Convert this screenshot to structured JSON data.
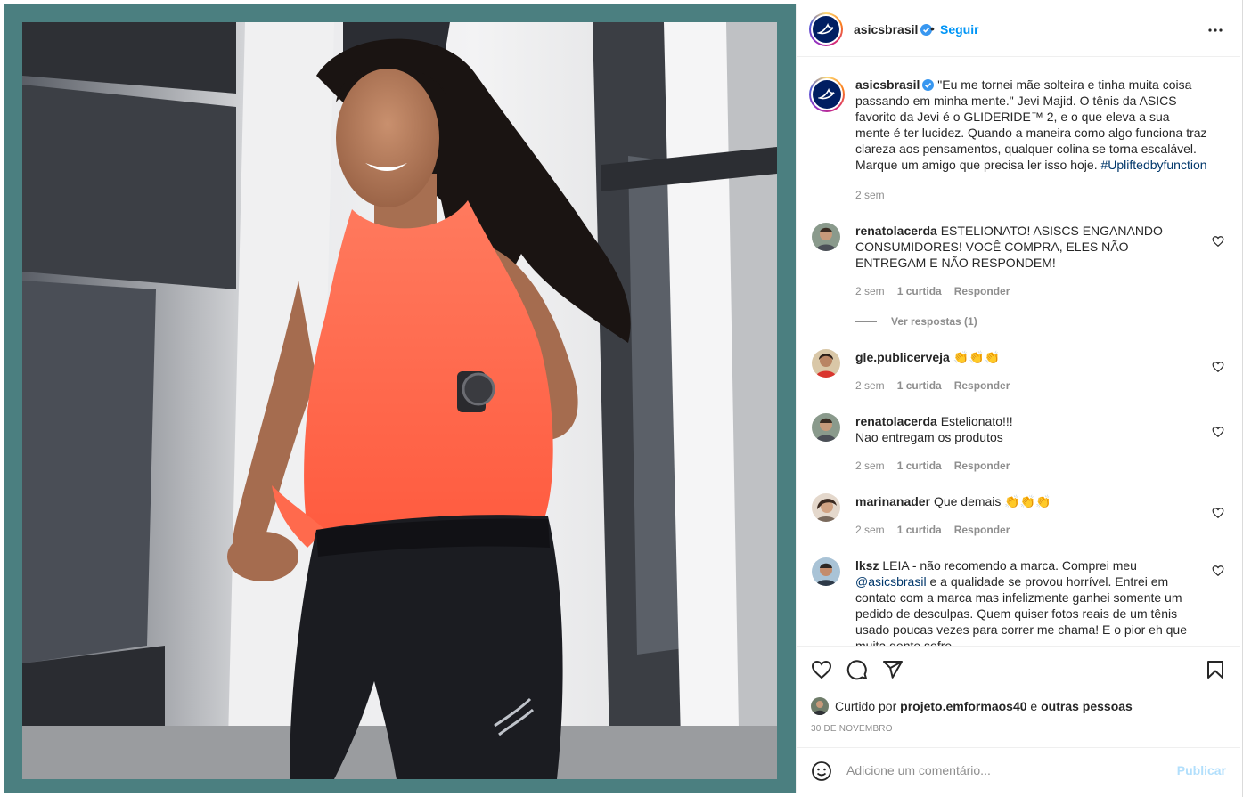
{
  "post": {
    "username": "asicsbrasil",
    "follow_label": "Seguir",
    "dot": "•",
    "caption": {
      "username": "asicsbrasil",
      "text": "\"Eu me tornei mãe solteira e tinha muita coisa passando em minha mente.\" Jevi Majid. O tênis da ASICS favorito da Jevi é o GLIDERIDE™ 2, e o que eleva a sua mente é ter lucidez. Quando a maneira como algo funciona traz clareza aos pensamentos, qualquer colina se torna escalável. Marque um amigo que precisa ler isso hoje.",
      "hashtag": "#Upliftedbyfunction",
      "time": "2 sem"
    },
    "comments": [
      {
        "username": "renatolacerda",
        "text": "ESTELIONATO! ASISCS ENGANANDO CONSUMIDORES! VOCÊ COMPRA, ELES NÃO ENTREGAM E NÃO RESPONDEM!",
        "time": "2 sem",
        "likes": "1 curtida",
        "reply": "Responder",
        "view_replies": "Ver respostas (1)"
      },
      {
        "username": "gle.publicerveja",
        "text": "👏👏👏",
        "time": "2 sem",
        "likes": "1 curtida",
        "reply": "Responder"
      },
      {
        "username": "renatolacerda",
        "text": "Estelionato!!!",
        "text2": "Nao entregam os produtos",
        "time": "2 sem",
        "likes": "1 curtida",
        "reply": "Responder"
      },
      {
        "username": "marinanader",
        "text": "Que demais 👏👏👏",
        "time": "2 sem",
        "likes": "1 curtida",
        "reply": "Responder"
      },
      {
        "username": "lksz",
        "text_before": "LEIA - não recomendo a marca. Comprei meu",
        "mention": "@asicsbrasil",
        "text_after": "e a qualidade se provou horrível. Entrei em contato com a marca mas infelizmente ganhei somente um pedido de desculpas. Quem quiser fotos reais de um tênis usado poucas vezes para correr me chama! E o pior eh que muita gente sofre"
      }
    ],
    "liked_by": {
      "prefix": "Curtido por",
      "user": "projeto.emformaos40",
      "conj": "e",
      "others": "outras pessoas"
    },
    "date": "30 DE NOVEMBRO",
    "add_comment_placeholder": "Adicione um comentário...",
    "publish_label": "Publicar"
  },
  "colors": {
    "frame_teal": "#4b7f80",
    "follow_blue": "#0095f6",
    "hashtag_blue": "#00376b",
    "muted_gray": "#8e8e8e",
    "publish_disabled": "#b2dffc",
    "asics_navy": "#001e62",
    "shirt_coral": "#ff6b4f"
  },
  "icons": [
    "verified-badge-icon",
    "more-options-icon",
    "heart-icon",
    "comment-icon",
    "share-icon",
    "bookmark-icon",
    "emoji-icon",
    "asics-logo-icon"
  ]
}
